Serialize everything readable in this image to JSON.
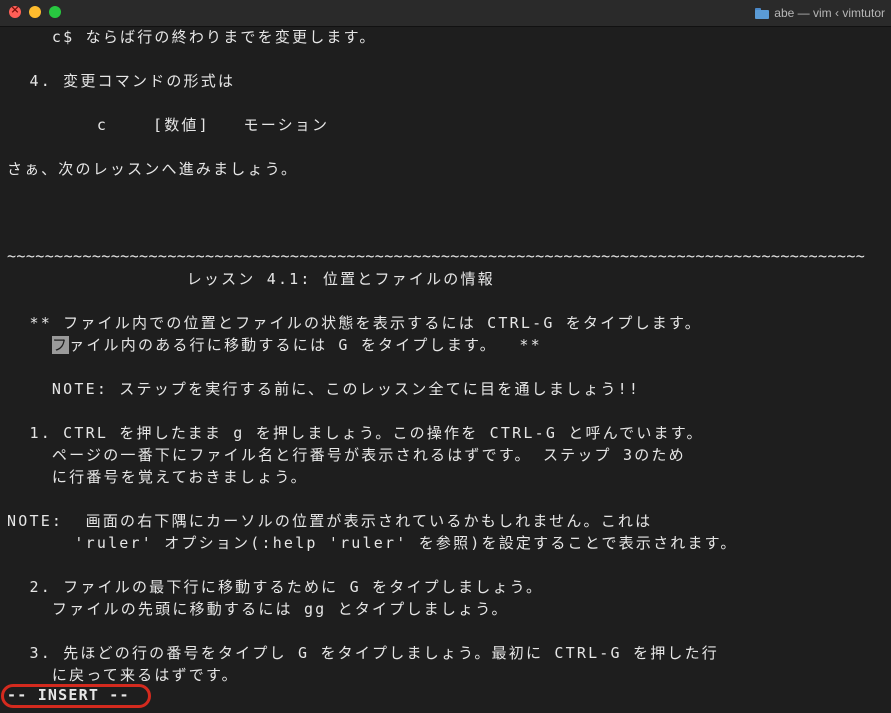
{
  "window": {
    "title": "abe — vim ‹ vimtutor"
  },
  "editor": {
    "lines": [
      "    c$ ならば行の終わりまでを変更します。",
      "",
      "  4. 変更コマンドの形式は",
      "",
      "        c    [数値]   モーション",
      "",
      "さぁ、次のレッスンへ進みましょう。",
      "",
      "",
      "",
      "",
      "                レッスン 4.1: 位置とファイルの情報",
      "",
      "  ** ファイル内での位置とファイルの状態を表示するには CTRL-G をタイプします。",
      "    ",
      "",
      "    NOTE: ステップを実行する前に、このレッスン全てに目を通しましょう!!",
      "",
      "  1. CTRL を押したまま g を押しましょう。この操作を CTRL-G と呼んでいます。",
      "    ページの一番下にファイル名と行番号が表示されるはずです。 ステップ 3のため",
      "    に行番号を覚えておきましょう。",
      "",
      "NOTE:  画面の右下隅にカーソルの位置が表示されているかもしれません。これは",
      "      'ruler' オプション(:help 'ruler' を参照)を設定することで表示されます。",
      "",
      "  2. ファイルの最下行に移動するために G をタイプしましょう。",
      "    ファイルの先頭に移動するには gg とタイプしましょう。",
      "",
      "  3. 先ほどの行の番号をタイプし G をタイプしましょう。最初に CTRL-G を押した行",
      "    に戻って来るはずです。"
    ],
    "cursor_line": {
      "prefix": "    ",
      "cursor_char": "フ",
      "rest": "ァイル内のある行に移動するには G をタイプします。  **"
    },
    "separator": "~~~~~~~~~~~~~~~~~~~~~~~~~~~~~~~~~~~~~~~~~~~~~~~~~~~~~~~~~~~~~~~~~~~~~~~~~~~~~~~~~~~~~~~~~~~~~~~~~~~~~~~~~~~~~~~~~~~~~~~~~~~~~~~~~~"
  },
  "status": {
    "mode": "-- INSERT --",
    "highlight_color": "#d42a1e"
  }
}
